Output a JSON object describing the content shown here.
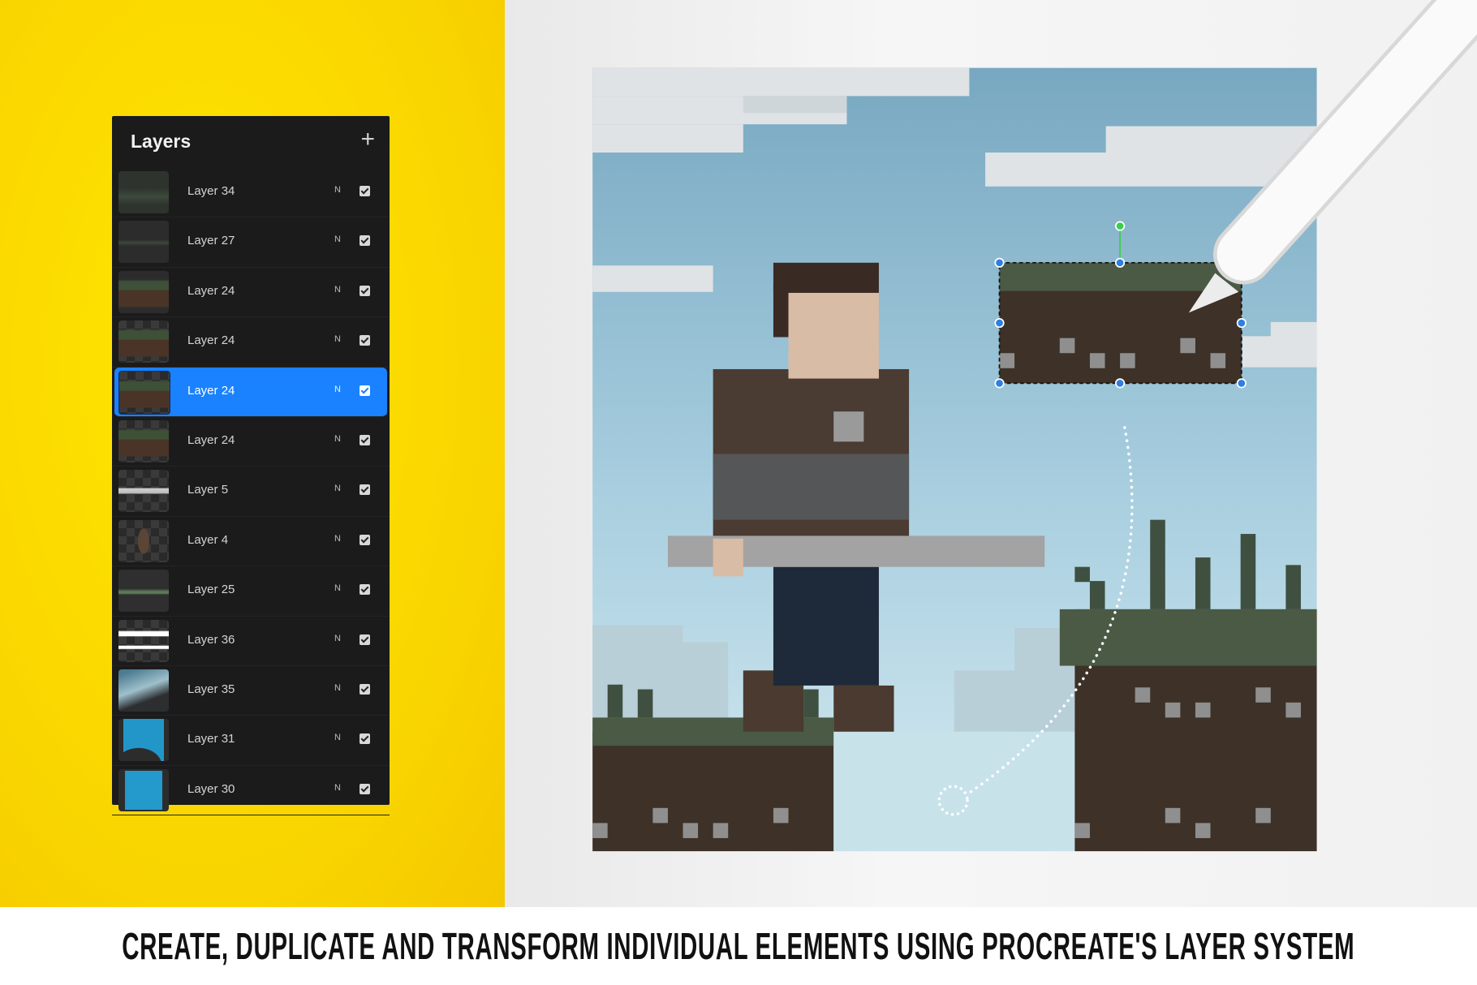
{
  "panel": {
    "title": "Layers",
    "add_icon": "plus-icon",
    "selected_index": 4,
    "layers": [
      {
        "name": "Layer 34",
        "blend": "N",
        "visible": true,
        "thumb": "grass-tufts"
      },
      {
        "name": "Layer 27",
        "blend": "N",
        "visible": true,
        "thumb": "grass-line"
      },
      {
        "name": "Layer 24",
        "blend": "N",
        "visible": true,
        "thumb": "ground"
      },
      {
        "name": "Layer 24",
        "blend": "N",
        "visible": true,
        "thumb": "ground-checker"
      },
      {
        "name": "Layer 24",
        "blend": "N",
        "visible": true,
        "thumb": "ground-checker"
      },
      {
        "name": "Layer 24",
        "blend": "N",
        "visible": true,
        "thumb": "ground-checker"
      },
      {
        "name": "Layer 5",
        "blend": "N",
        "visible": true,
        "thumb": "sword"
      },
      {
        "name": "Layer 4",
        "blend": "N",
        "visible": true,
        "thumb": "character"
      },
      {
        "name": "Layer 25",
        "blend": "N",
        "visible": true,
        "thumb": "hills"
      },
      {
        "name": "Layer 36",
        "blend": "N",
        "visible": true,
        "thumb": "clouds"
      },
      {
        "name": "Layer 35",
        "blend": "N",
        "visible": true,
        "thumb": "gradient"
      },
      {
        "name": "Layer 31",
        "blend": "N",
        "visible": true,
        "thumb": "blue-arc"
      },
      {
        "name": "Layer 30",
        "blend": "N",
        "visible": true,
        "thumb": "blue-fill"
      }
    ]
  },
  "colors": {
    "yellow": "#f9d400",
    "selection": "#1a82ff",
    "panel": "#1b1b1c",
    "sky_top": "#78a8c1",
    "sky_bottom": "#cfe6ee",
    "dirt": "#3d3128",
    "grass": "#4a5a44",
    "handle": "#2f7fe0",
    "rotate_handle": "#3ccc4a"
  },
  "caption": "CREATE, DUPLICATE AND TRANSFORM INDIVIDUAL ELEMENTS USING PROCREATE'S LAYER SYSTEM"
}
